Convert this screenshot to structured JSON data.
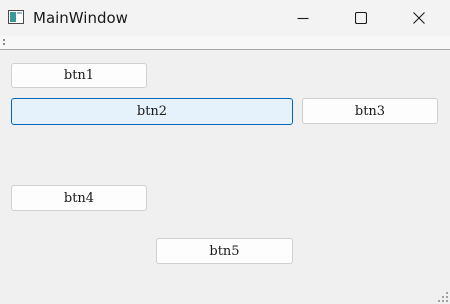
{
  "window": {
    "title": "MainWindow"
  },
  "icons": {
    "app": "window-app-icon",
    "minimize": "minimize-icon",
    "maximize": "maximize-icon",
    "close": "close-icon",
    "toolbar_handle": "toolbar-handle-icon",
    "size_grip": "size-grip-icon"
  },
  "buttons": {
    "btn1": "btn1",
    "btn2": "btn2",
    "btn3": "btn3",
    "btn4": "btn4",
    "btn5": "btn5"
  },
  "colors": {
    "focus_border": "#0067c0",
    "focus_fill": "#e5f1fb",
    "window_bg": "#f0f0f0"
  }
}
